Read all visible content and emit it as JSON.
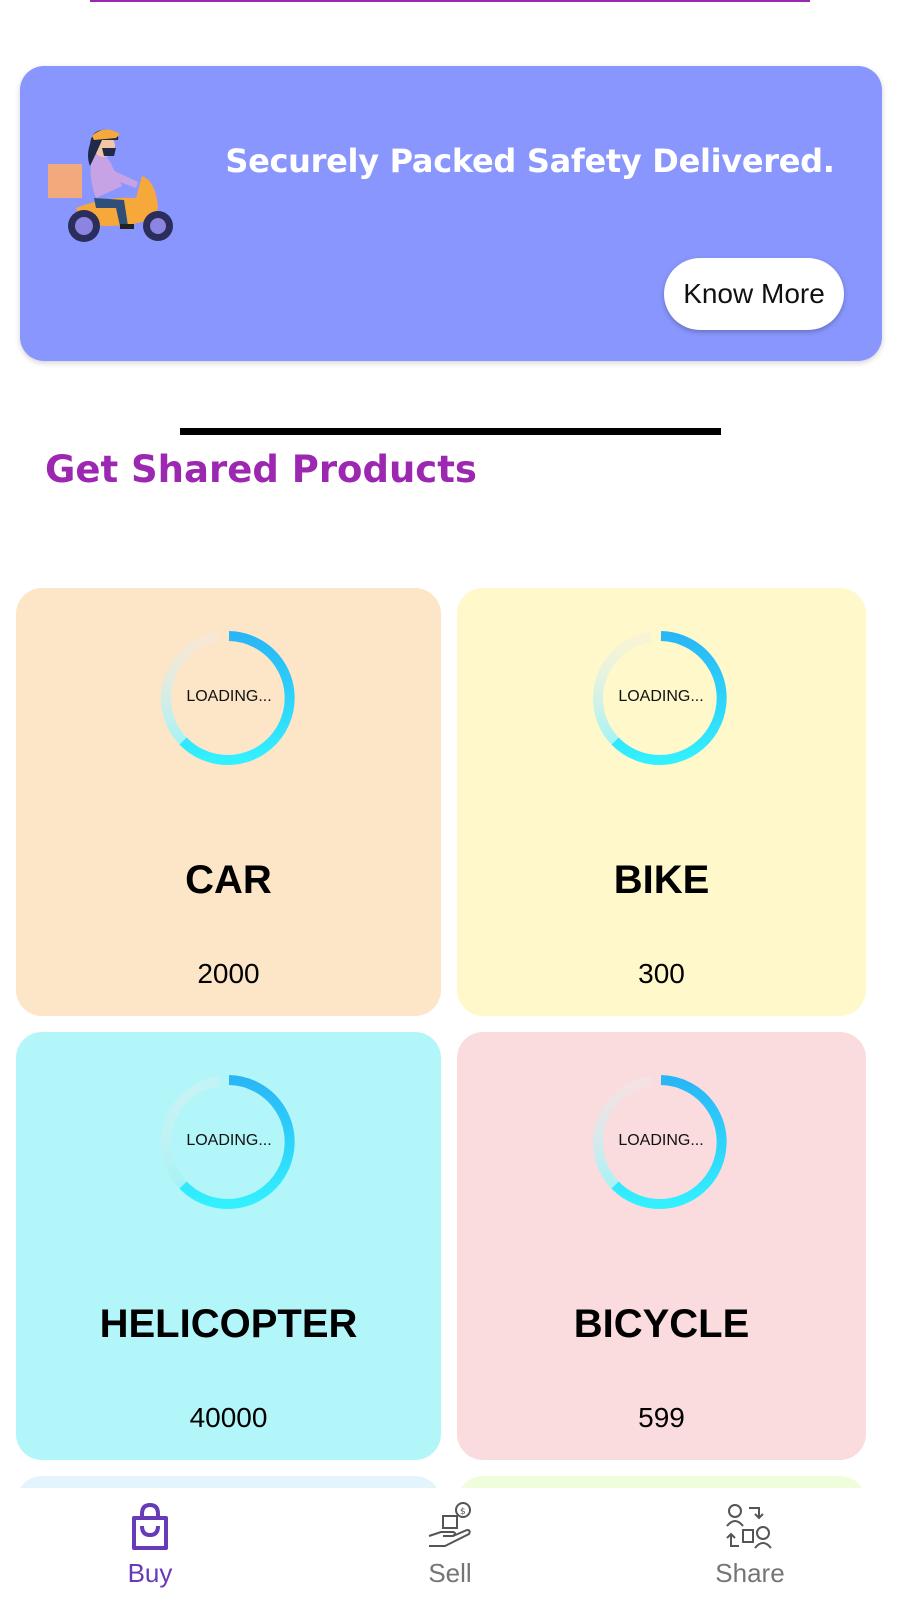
{
  "banner": {
    "headline": "Securely Packed Safety Delivered.",
    "button_label": "Know More",
    "background_color": "#8896fd"
  },
  "section": {
    "title": "Get Shared Products",
    "title_color": "#9c27b0"
  },
  "products": [
    {
      "name": "CAR",
      "price": "2000",
      "loading_text": "LOADING...",
      "bg_color": "#fde6c8"
    },
    {
      "name": "BIKE",
      "price": "300",
      "loading_text": "LOADING...",
      "bg_color": "#fef8ca"
    },
    {
      "name": "HELICOPTER",
      "price": "40000",
      "loading_text": "LOADING...",
      "bg_color": "#b2f6fa"
    },
    {
      "name": "BICYCLE",
      "price": "599",
      "loading_text": "LOADING...",
      "bg_color": "#fadcdf"
    }
  ],
  "partial_cards": [
    {
      "bg_color": "#e3f4fd"
    },
    {
      "bg_color": "#effddb"
    }
  ],
  "bottom_nav": {
    "items": [
      {
        "label": "Buy",
        "icon": "shopping-bag-icon",
        "active": true
      },
      {
        "label": "Sell",
        "icon": "sell-hand-box-icon",
        "active": false
      },
      {
        "label": "Share",
        "icon": "share-people-icon",
        "active": false
      }
    ],
    "active_color": "#673ab7",
    "inactive_color": "#757575"
  }
}
